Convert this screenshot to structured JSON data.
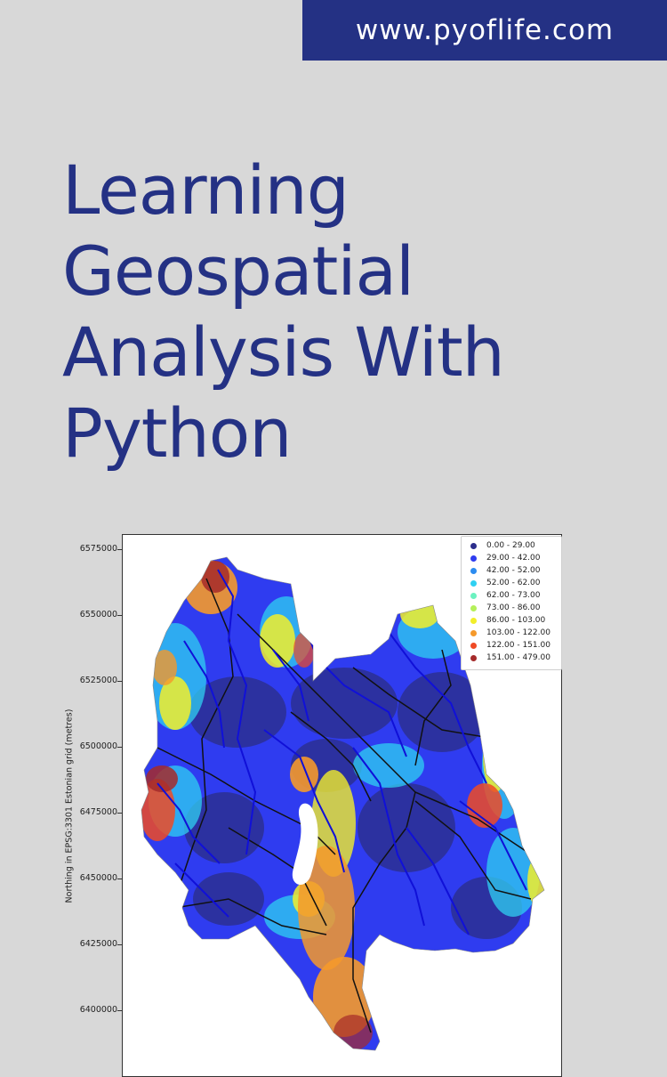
{
  "header": {
    "url": "www.pyoflife.com"
  },
  "title": {
    "lines": [
      "Learning",
      "Geospatial",
      "Analysis With",
      "Python"
    ]
  },
  "colors": {
    "brand": "#243184",
    "background": "#d8d8d8"
  },
  "chart_data": {
    "type": "heatmap",
    "ylabel": "Northing in EPSG:3301 Estonian grid (metres)",
    "yticks": [
      "6575000",
      "6550000",
      "6525000",
      "6500000",
      "6475000",
      "6450000",
      "6425000",
      "6400000"
    ],
    "legend": [
      {
        "label": "0.00 - 29.00",
        "color": "#2c2e8c"
      },
      {
        "label": "29.00 - 42.00",
        "color": "#2f3cf0"
      },
      {
        "label": "42.00 - 52.00",
        "color": "#2c8cf0"
      },
      {
        "label": "52.00 - 62.00",
        "color": "#2fd0f2"
      },
      {
        "label": "62.00 - 73.00",
        "color": "#6cf2c0"
      },
      {
        "label": "73.00 - 86.00",
        "color": "#b4f05a"
      },
      {
        "label": "86.00 - 103.00",
        "color": "#f2ee2a"
      },
      {
        "label": "103.00 - 122.00",
        "color": "#f5992b"
      },
      {
        "label": "122.00 - 151.00",
        "color": "#ef4a25"
      },
      {
        "label": "151.00 - 479.00",
        "color": "#a52a2a"
      }
    ]
  }
}
